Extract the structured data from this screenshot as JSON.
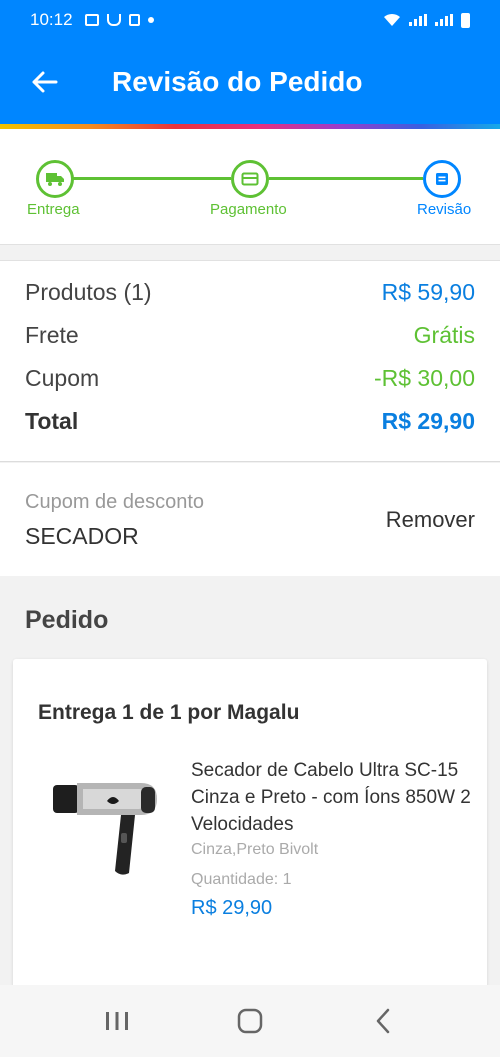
{
  "status_bar": {
    "time": "10:12"
  },
  "app_bar": {
    "title": "Revisão do Pedido"
  },
  "stepper": {
    "steps": [
      {
        "label": "Entrega",
        "icon": "truck-icon"
      },
      {
        "label": "Pagamento",
        "icon": "card-icon"
      },
      {
        "label": "Revisão",
        "icon": "review-icon"
      }
    ],
    "current_step": 3
  },
  "summary": {
    "products_label": "Produtos (1)",
    "products_value": "R$ 59,90",
    "shipping_label": "Frete",
    "shipping_value": "Grátis",
    "coupon_label": "Cupom",
    "coupon_value": "-R$ 30,00",
    "total_label": "Total",
    "total_value": "R$ 29,90"
  },
  "coupon": {
    "label": "Cupom de desconto",
    "code": "SECADOR",
    "remove_label": "Remover"
  },
  "order": {
    "section_title": "Pedido",
    "delivery_title": "Entrega 1 de 1 por Magalu",
    "product": {
      "name": "Secador de Cabelo Ultra SC-15 Cinza e Preto - com Íons 850W 2 Velocidades",
      "variant": "Cinza,Preto Bivolt",
      "quantity": "Quantidade:  1",
      "price": "R$ 29,90"
    }
  },
  "colors": {
    "primary": "#0086ff",
    "success": "#5ec134",
    "price": "#0a7fe0"
  }
}
